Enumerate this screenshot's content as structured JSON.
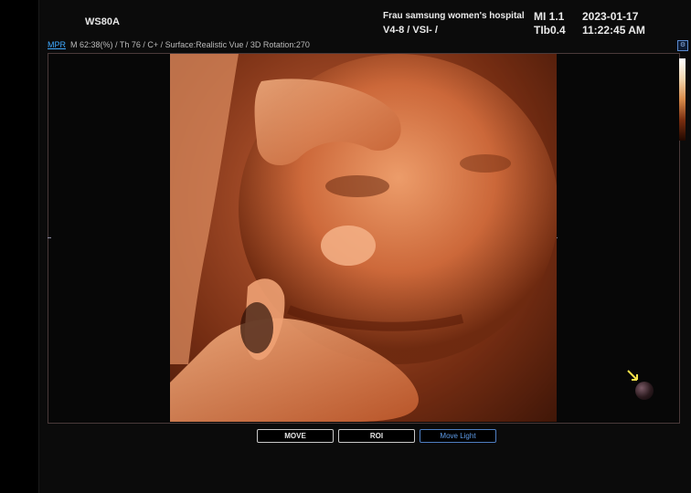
{
  "header": {
    "device": "WS80A",
    "hospital": "Frau samsung women's hospital",
    "probe": "V4-8 / VSI- /",
    "mi": "MI  1.1",
    "tib": "TIb0.4",
    "date": "2023-01-17",
    "time": "11:22:45 AM"
  },
  "viewer": {
    "mode_tab": "MPR",
    "params": "M 62:38(%) / Th 76 / C+ / Surface:Realistic Vue / 3D Rotation:270"
  },
  "toolbar": {
    "buttons": [
      {
        "label": "MOVE",
        "active": false
      },
      {
        "label": "ROI",
        "active": false
      },
      {
        "label": "Move Light",
        "active": true
      }
    ]
  },
  "colors": {
    "accent": "#3fa9ff",
    "skin_mid": "#c85f34",
    "skin_light": "#e88a58",
    "arrow": "#f2e14a"
  },
  "icons": {
    "corner": "settings-icon",
    "light": "light-source-icon",
    "arrow": "arrow-pointer-icon"
  }
}
